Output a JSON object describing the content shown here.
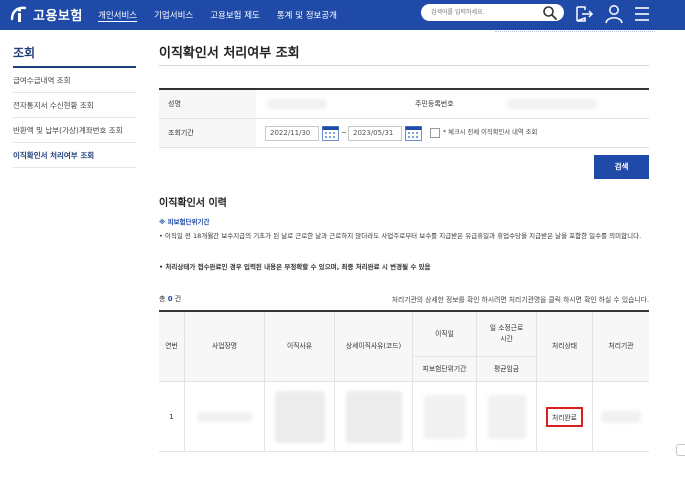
{
  "header": {
    "logo_text": "고용보험",
    "nav": [
      "개인서비스",
      "기업서비스",
      "고용보험 제도",
      "통계 및 정보공개"
    ],
    "search_placeholder": "검색어를 입력하세요."
  },
  "sidebar": {
    "title": "조회",
    "items": [
      {
        "label": "급여수급내역 조회"
      },
      {
        "label": "전자통지서 수신현황 조회"
      },
      {
        "label": "반환액 및 납부(가상)계좌번호 조회"
      },
      {
        "label": "이직확인서 처리여부 조회"
      }
    ]
  },
  "page": {
    "title": "이직확인서 처리여부 조회"
  },
  "form": {
    "name_label": "성명",
    "rrn_label": "주민등록번호",
    "period_label": "조회기간",
    "date_from": "2022/11/30",
    "date_sep": "~",
    "date_to": "2023/05/31",
    "checkbox_label": "* 체크시 전체 이직확인서 내역 조회",
    "search_button": "검색"
  },
  "history": {
    "title": "이직확인서 이력",
    "notice_head": "※ 피보험단위기간",
    "notice_1": "• 이직일 전 18개월간 보수지급의 기초가 된 날로 근로한 날과 근로하지 않더라도 사업주로부터 보수를 지급받은 유급휴일과 휴업수당을 지급받은 날을 포함한 일수를 의미합니다.",
    "notice_2": "• 처리상태가 접수완료인 경우 입력된 내용은 부정확할 수 있으며, 최종 처리완료 시 변경될 수 있음",
    "total_prefix": "총",
    "total_count": "0",
    "total_suffix": "건",
    "hint": "처리기관의 상세한 정보를 확인 하시려면 처리기관명을 클릭 하시면 확인 하실 수 있습니다."
  },
  "table": {
    "headers": {
      "no": "연번",
      "company": "사업장명",
      "reason": "이직사유",
      "detail_reason": "상세이직사유(코드)",
      "separation_date": "이직일",
      "insured_period": "피보험단위기간",
      "avg_hours": "일 소정근로시간",
      "avg_wage": "평균임금",
      "status": "처리상태",
      "agency": "처리기관"
    },
    "rows": [
      {
        "no": "1",
        "status": "처리완료"
      }
    ]
  },
  "colors": {
    "brand": "#1f4aa8",
    "status_highlight": "#d92020"
  }
}
